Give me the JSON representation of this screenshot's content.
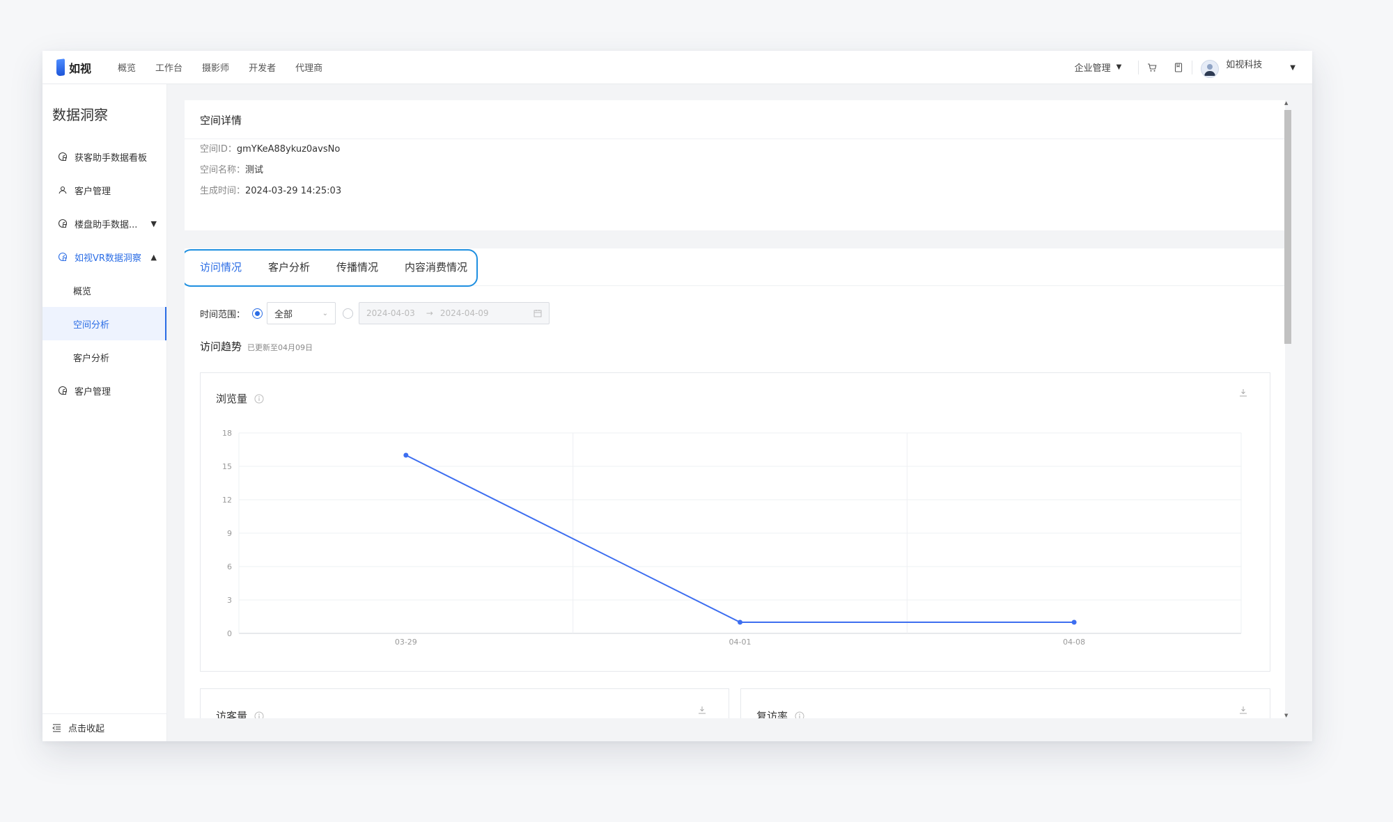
{
  "app": {
    "logo_text": "如视",
    "nav": [
      "概览",
      "工作台",
      "摄影师",
      "开发者",
      "代理商"
    ],
    "org_label": "企业管理",
    "user_name": "如视科技"
  },
  "sidebar": {
    "title": "数据洞察",
    "items": [
      {
        "label": "获客助手数据看板",
        "icon": "dashboard-icon"
      },
      {
        "label": "客户管理",
        "icon": "user-group-icon"
      },
      {
        "label": "楼盘助手数据...",
        "icon": "dashboard-icon",
        "chevron": "down"
      },
      {
        "label": "如视VR数据洞察",
        "icon": "dashboard-icon",
        "chevron": "up"
      },
      {
        "label": "概览"
      },
      {
        "label": "空间分析",
        "active": true
      },
      {
        "label": "客户分析"
      },
      {
        "label": "客户管理",
        "icon": "dashboard-icon"
      }
    ],
    "collapse_label": "点击收起"
  },
  "detail": {
    "title": "空间详情",
    "rows": [
      {
        "key": "空间ID：",
        "value": "gmYKeA88ykuz0avsNo"
      },
      {
        "key": "空间名称：",
        "value": "测试"
      },
      {
        "key": "生成时间：",
        "value": "2024-03-29 14:25:03"
      }
    ]
  },
  "tabs": [
    "访问情况",
    "客户分析",
    "传播情况",
    "内容消费情况"
  ],
  "filter": {
    "label": "时间范围：",
    "select_value": "全部",
    "range_start": "2024-04-03",
    "range_end": "2024-04-09"
  },
  "trend": {
    "title": "访问趋势",
    "updated": "已更新至04月09日"
  },
  "charts": {
    "views_title": "浏览量",
    "visitors_title": "访客量",
    "return_rate_title": "复访率"
  },
  "colors": {
    "accent": "#2b6de5",
    "line": "#3d6ef0",
    "highlight_outline": "#1e8fe0"
  },
  "chart_data": {
    "type": "line",
    "title": "浏览量",
    "categories": [
      "03-29",
      "04-01",
      "04-08"
    ],
    "series": [
      {
        "values": [
          16,
          1,
          1
        ]
      }
    ],
    "ylim": [
      0,
      18
    ],
    "yticks": [
      0,
      3,
      6,
      9,
      12,
      15,
      18
    ],
    "grid": true
  }
}
